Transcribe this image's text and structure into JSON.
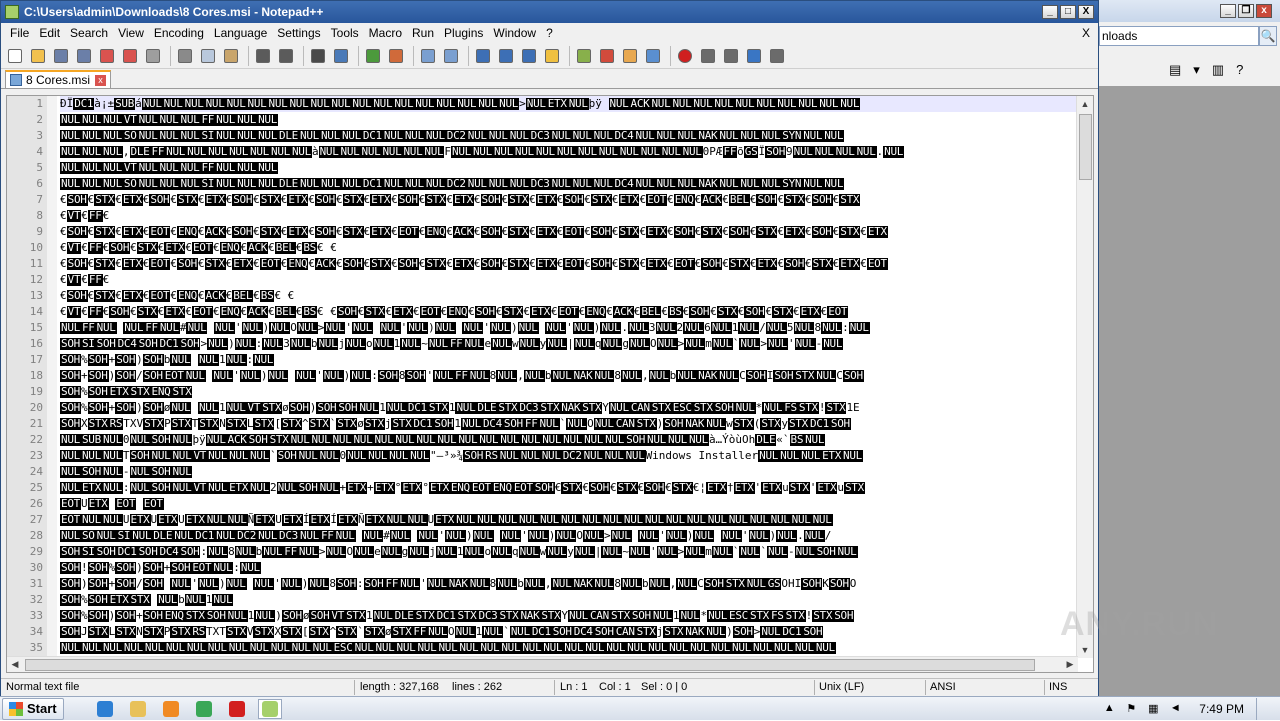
{
  "window": {
    "title": "C:\\Users\\admin\\Downloads\\8 Cores.msi - Notepad++",
    "minimize_label": "_",
    "maximize_label": "□",
    "close_label": "X"
  },
  "menu": {
    "items": [
      "File",
      "Edit",
      "Search",
      "View",
      "Encoding",
      "Language",
      "Settings",
      "Tools",
      "Macro",
      "Run",
      "Plugins",
      "Window",
      "?"
    ],
    "close_doc": "X"
  },
  "toolbar": {
    "icons": [
      {
        "name": "new-file-icon",
        "color": "#ffffff"
      },
      {
        "name": "open-file-icon",
        "color": "#f2c14e"
      },
      {
        "name": "save-icon",
        "color": "#6b7fa8"
      },
      {
        "name": "save-all-icon",
        "color": "#6b7fa8"
      },
      {
        "name": "close-icon",
        "color": "#d9534f"
      },
      {
        "name": "close-all-icon",
        "color": "#d9534f"
      },
      {
        "name": "print-icon",
        "color": "#9e9e9e"
      },
      {
        "name": "cut-icon",
        "color": "#8a8a8a"
      },
      {
        "name": "copy-icon",
        "color": "#b9c8dc"
      },
      {
        "name": "paste-icon",
        "color": "#c9a56b"
      },
      {
        "name": "undo-icon",
        "color": "#5b5b5b"
      },
      {
        "name": "redo-icon",
        "color": "#5b5b5b"
      },
      {
        "name": "find-icon",
        "color": "#4a4a4a"
      },
      {
        "name": "replace-icon",
        "color": "#4a7ab8"
      },
      {
        "name": "zoom-in-icon",
        "color": "#4c9a3c"
      },
      {
        "name": "zoom-out-icon",
        "color": "#d06a3a"
      },
      {
        "name": "sync-vertical-icon",
        "color": "#7a9fd0"
      },
      {
        "name": "sync-horizontal-icon",
        "color": "#7a9fd0"
      },
      {
        "name": "word-wrap-icon",
        "color": "#3d6fb5"
      },
      {
        "name": "show-all-chars-icon",
        "color": "#3d6fb5"
      },
      {
        "name": "indent-guide-icon",
        "color": "#3d6fb5"
      },
      {
        "name": "lang-define-icon",
        "color": "#f0c040"
      },
      {
        "name": "doc-map-icon",
        "color": "#88b04b"
      },
      {
        "name": "function-list-icon",
        "color": "#d24b3c"
      },
      {
        "name": "folder-workspace-icon",
        "color": "#e8a850"
      },
      {
        "name": "monitoring-icon",
        "color": "#5a8fd0"
      },
      {
        "name": "record-macro-icon",
        "color": "#d01f1f"
      },
      {
        "name": "stop-macro-icon",
        "color": "#6b6b6b"
      },
      {
        "name": "play-macro-icon",
        "color": "#6b6b6b"
      },
      {
        "name": "run-macro-multiple-icon",
        "color": "#3a76c4"
      },
      {
        "name": "save-macro-icon",
        "color": "#6b6b6b"
      }
    ]
  },
  "tab": {
    "label": "8 Cores.msi",
    "close": "x"
  },
  "editor": {
    "line_numbers": [
      "1",
      "2",
      "3",
      "4",
      "5",
      "6",
      "7",
      "8",
      "9",
      "10",
      "11",
      "12",
      "13",
      "14",
      "15",
      "16",
      "17",
      "18",
      "19",
      "20",
      "21",
      "22",
      "23",
      "24",
      "25",
      "26",
      "27",
      "28",
      "29",
      "30",
      "31",
      "32",
      "33",
      "34",
      "35"
    ],
    "lines": [
      "ÐÏDC1à¡±SUBáNULNULNULNULNULNULNULNULNULNULNULNULNULNULNULNULNULNUL>NULETXNULþÿ  NULACKNULNULNULNULNULNULNULNULNULNUL",
      "NULNULNULVTNULNULNULFFNULNULNUL",
      "NULNULNULSONULNULNULSINULNULNULDLENULNULNULDC1NULNULNULDC2NULNULNULDC3NULNULNULDC4NULNULNULNAKNULNULNULSYNNULNUL",
      "NULNULNUL,DLEFFNULNULNULNULNULNULNULàNULNULNULNULNULNULFNULNULNULNULNULNULNULNULNULNULNULNUL0PÆFFõGSÏSOH9NULNULNULNUL.NUL",
      "NULNULNULVTNULNULNULFFNULNULNUL",
      "NULNULNULSONULNULNULSINULNULNULDLENULNULNULDC1NULNULNULDC2NULNULNULDC3NULNULNULDC4NULNULNULNAKNULNULNULSYNNULNUL",
      "€SOH€STX€ETX€SOH€STX€ETX€SOH€STX€ETX€SOH€STX€ETX€SOH€STX€ETX€SOH€STX€ETX€SOH€STX€ETX€EOT€ENQ€ACK€BEL€SOH€STX€SOH€STX",
      "€VT€FF€",
      "€SOH€STX€ETX€EOT€ENQ€ACK€SOH€STX€ETX€SOH€STX€ETX€EOT€ENQ€ACK€SOH€STX€ETX€EOT€SOH€STX€ETX€SOH€STX€SOH€STX€ETX€SOH€STX€ETX",
      "€VT€FF€SOH€STX€ETX€EOT€ENQ€ACK€BEL€BS€  €",
      "€SOH€STX€ETX€EOT€SOH€STX€ETX€EOT€ENQ€ACK€SOH€STX€SOH€STX€ETX€SOH€STX€ETX€EOT€SOH€STX€ETX€EOT€SOH€STX€ETX€SOH€STX€ETX€EOT",
      "€VT€FF€",
      "€SOH€STX€ETX€EOT€ENQ€ACK€BEL€BS€ €",
      "€VT€FF€SOH€STX€ETX€EOT€ENQ€ACK€BEL€BS€  €SOH€STX€ETX€EOT€ENQ€SOH€STX€ETX€EOT€ENQ€ACK€BEL€BS€SOH€STX€SOH€STX€ETX€EOT",
      "NULFFNUL NULFFNUL#NUL NUL'NUL)NULONUL>NUL'NUL NUL'NUL)NUL NUL'NUL)NUL NUL'NUL)NUL.NUL3NUL2NUL6NUL1NUL/NUL5NUL8NUL:NUL",
      "SOHSISOHDC4SOHDC1SOH>NUL)NUL:NUL3NULbNULjNULoNUL1NUL~NULFFNULeNULwNULyNUL|NULqNULgNULONUL>NULmNUL`NUL>NUL'NUL-NUL",
      "SOH%SOH+SOH)SOHbNUL NUL1NUL:NUL",
      "SOH+SOH)SOH/SOHEOTNUL NUL'NUL)NUL NUL'NUL)NUL:SOH8SOH'NULFFNUL8NUL,NULbNULNAKNUL8NUL,NULbNULNAKNULCSOHISOHSTXNULCSOH",
      "SOH%SOHETXSTXENQSTX",
      "SOH%SOH+SOH)SOHøNUL NUL1NULVTSTXøSOH)SOHSOHNUL1NULDC1STX1NULDLESTXDC3STXNAKSTXYNULCANSTXESCSTXSOHNUL*NULFSSTX!STX1E",
      "SOHXSTXRSTXVSTXPSTXTSTXNSTXLSTX[STX^STX`STXøSTXjSTXDC1SOH1NULDC4SOHFFNUL`NULONULCANSTX)SOHNAKNULwSTX(STXySTXDC1SOH",
      "NULSUBNUL0NULSOHNULþÿNULACKSOHSTXNULNULNULNULNULNULNULNULNULNULNULNULNULNULNULNULSOHNULNULNULà…ÝòùOhDLE«`BSNUL",
      "NULNULNULTSOHNULNULVTNULNULNUL`SOHNULNUL0NULNULNULNUL\"–³»¾SOHRSNULNULNULDC2NULNULNULWindows InstallerNULNULNULETXNUL",
      "NULSOHNUL-NULSOHNUL",
      "NULETXNUL:NULSOHNULVTNULETXNUL2NULSOHNUL+ETX+ETX°ETX°ETXENQEOTENQEOTSOH€STX€SOH€STX€SOH€STX€¦ETX†ETX'ETXuSTX'ETXuSTX",
      "EOTUETX     EOT EOT",
      "EOTNULNULUETXUETXUETXNULNULÑETXUETXÍETXÍETXÑETXNULNULUETXNULNULNULNULNULNULNULNULNULNULNULNULNULNULNULNULNULNUL",
      "NULSONULSINULDLENULDC1NULDC2NULDC3NULFFNUL NUL#NUL NUL'NUL)NUL NUL'NUL)NULONUL>NUL NUL'NUL)NUL NUL'NUL)NUL.NUL/",
      "SOHSISOHDC1SOHDC4SOH:NUL8NULbNULFFNUL>NULONULeNULgNULjNUL1NULoNULqNULwNULyNUL|NUL~NUL'NUL>NULmNUL`NUL`NUL-NULSOHNUL",
      "SOH!SOH%SOH)SOH+SOHEOTNUL:NUL",
      "SOH)SOH+SOH/SOH NUL'NUL)NUL NUL'NUL)NUL8SOH:SOHFFNUL'NULNAKNUL8NULbNUL,NULNAKNUL8NULbNUL,NULCSOHSTXNULGSOHISOHKSOHO",
      "SOH%SOHETXSTX NULbNUL1NUL",
      "SOH%SOH)SOH+SOHENQSTXSOHNUL1NUL)SOHøSOHVTSTX1NULDLESTXDC1STXDC3STXNAKSTXYNULCANSTXSOHNUL1NUL*NULESCSTXFSSTX!STXSOH",
      "SOHJSTXLSTXNSTXPSTXRSTXTSTXVSTXXSTX[STX^STX`STXøSTXFFNULONUL1NUL`NULDC1SOHDC4SOHCANSTXjSTXNAKNUL)SOH>NULDC1SOH",
      "NULNULNULNULNULNULNULNULNULNULNULNULNULESCNULNULNULNULNULNULNULNULNULNULNULNULNULNULNULNULNULNULNULNULNULNULNUL"
    ]
  },
  "status": {
    "file_type": "Normal text file",
    "length": "length : 327,168",
    "lines": "lines : 262",
    "ln": "Ln : 1",
    "col": "Col : 1",
    "sel": "Sel : 0 | 0",
    "eol": "Unix (LF)",
    "encoding": "ANSI",
    "mode": "INS"
  },
  "background_window": {
    "address": "nloads",
    "search_icon": "🔍"
  },
  "taskbar": {
    "start_label": "Start",
    "clock": "7:49 PM",
    "items": [
      {
        "name": "ie-icon",
        "color": "#2d7fd3"
      },
      {
        "name": "explorer-icon",
        "color": "#e8c15a"
      },
      {
        "name": "media-player-icon",
        "color": "#f08a24"
      },
      {
        "name": "chrome-icon",
        "color": "#3aa757"
      },
      {
        "name": "opera-icon",
        "color": "#d21f1f"
      },
      {
        "name": "notepadpp-icon",
        "color": "#a6d06b"
      }
    ]
  },
  "watermark": "ANY.RUN"
}
